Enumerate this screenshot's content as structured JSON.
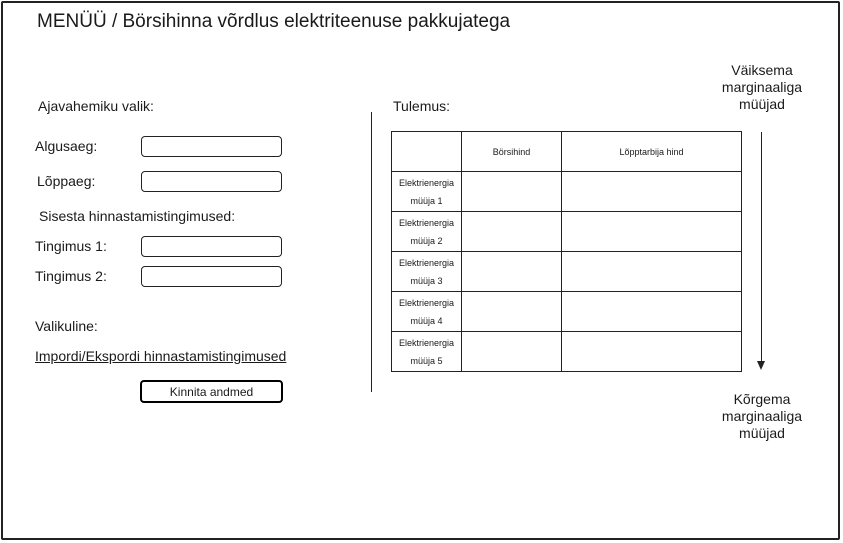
{
  "title": "MENÜÜ / Börsihinna võrdlus elektriteenuse pakkujatega",
  "form": {
    "time_range_heading": "Ajavahemiku valik:",
    "start_label": "Algusaeg:",
    "end_label": "Lõppaeg:",
    "conditions_heading": "Sisesta hinnastamistingimused:",
    "condition1_label": "Tingimus 1:",
    "condition2_label": "Tingimus 2:",
    "optional_label": "Valikuline:",
    "import_export_link": "Impordi/Ekspordi hinnastamistingimused",
    "confirm_button": "Kinnita andmed"
  },
  "results": {
    "heading": "Tulemus:",
    "columns": [
      "",
      "Börsihind",
      "Lõpptarbija hind"
    ],
    "rows": [
      {
        "seller": "Elektrienergia müüja 1",
        "exchange_price": "",
        "consumer_price": ""
      },
      {
        "seller": "Elektrienergia müüja 2",
        "exchange_price": "",
        "consumer_price": ""
      },
      {
        "seller": "Elektrienergia müüja 3",
        "exchange_price": "",
        "consumer_price": ""
      },
      {
        "seller": "Elektrienergia müüja 4",
        "exchange_price": "",
        "consumer_price": ""
      },
      {
        "seller": "Elektrienergia müüja 5",
        "exchange_price": "",
        "consumer_price": ""
      }
    ]
  },
  "legend": {
    "top": "Väiksema marginaaliga müüjad",
    "bottom": "Kõrgema marginaaliga müüjad"
  }
}
